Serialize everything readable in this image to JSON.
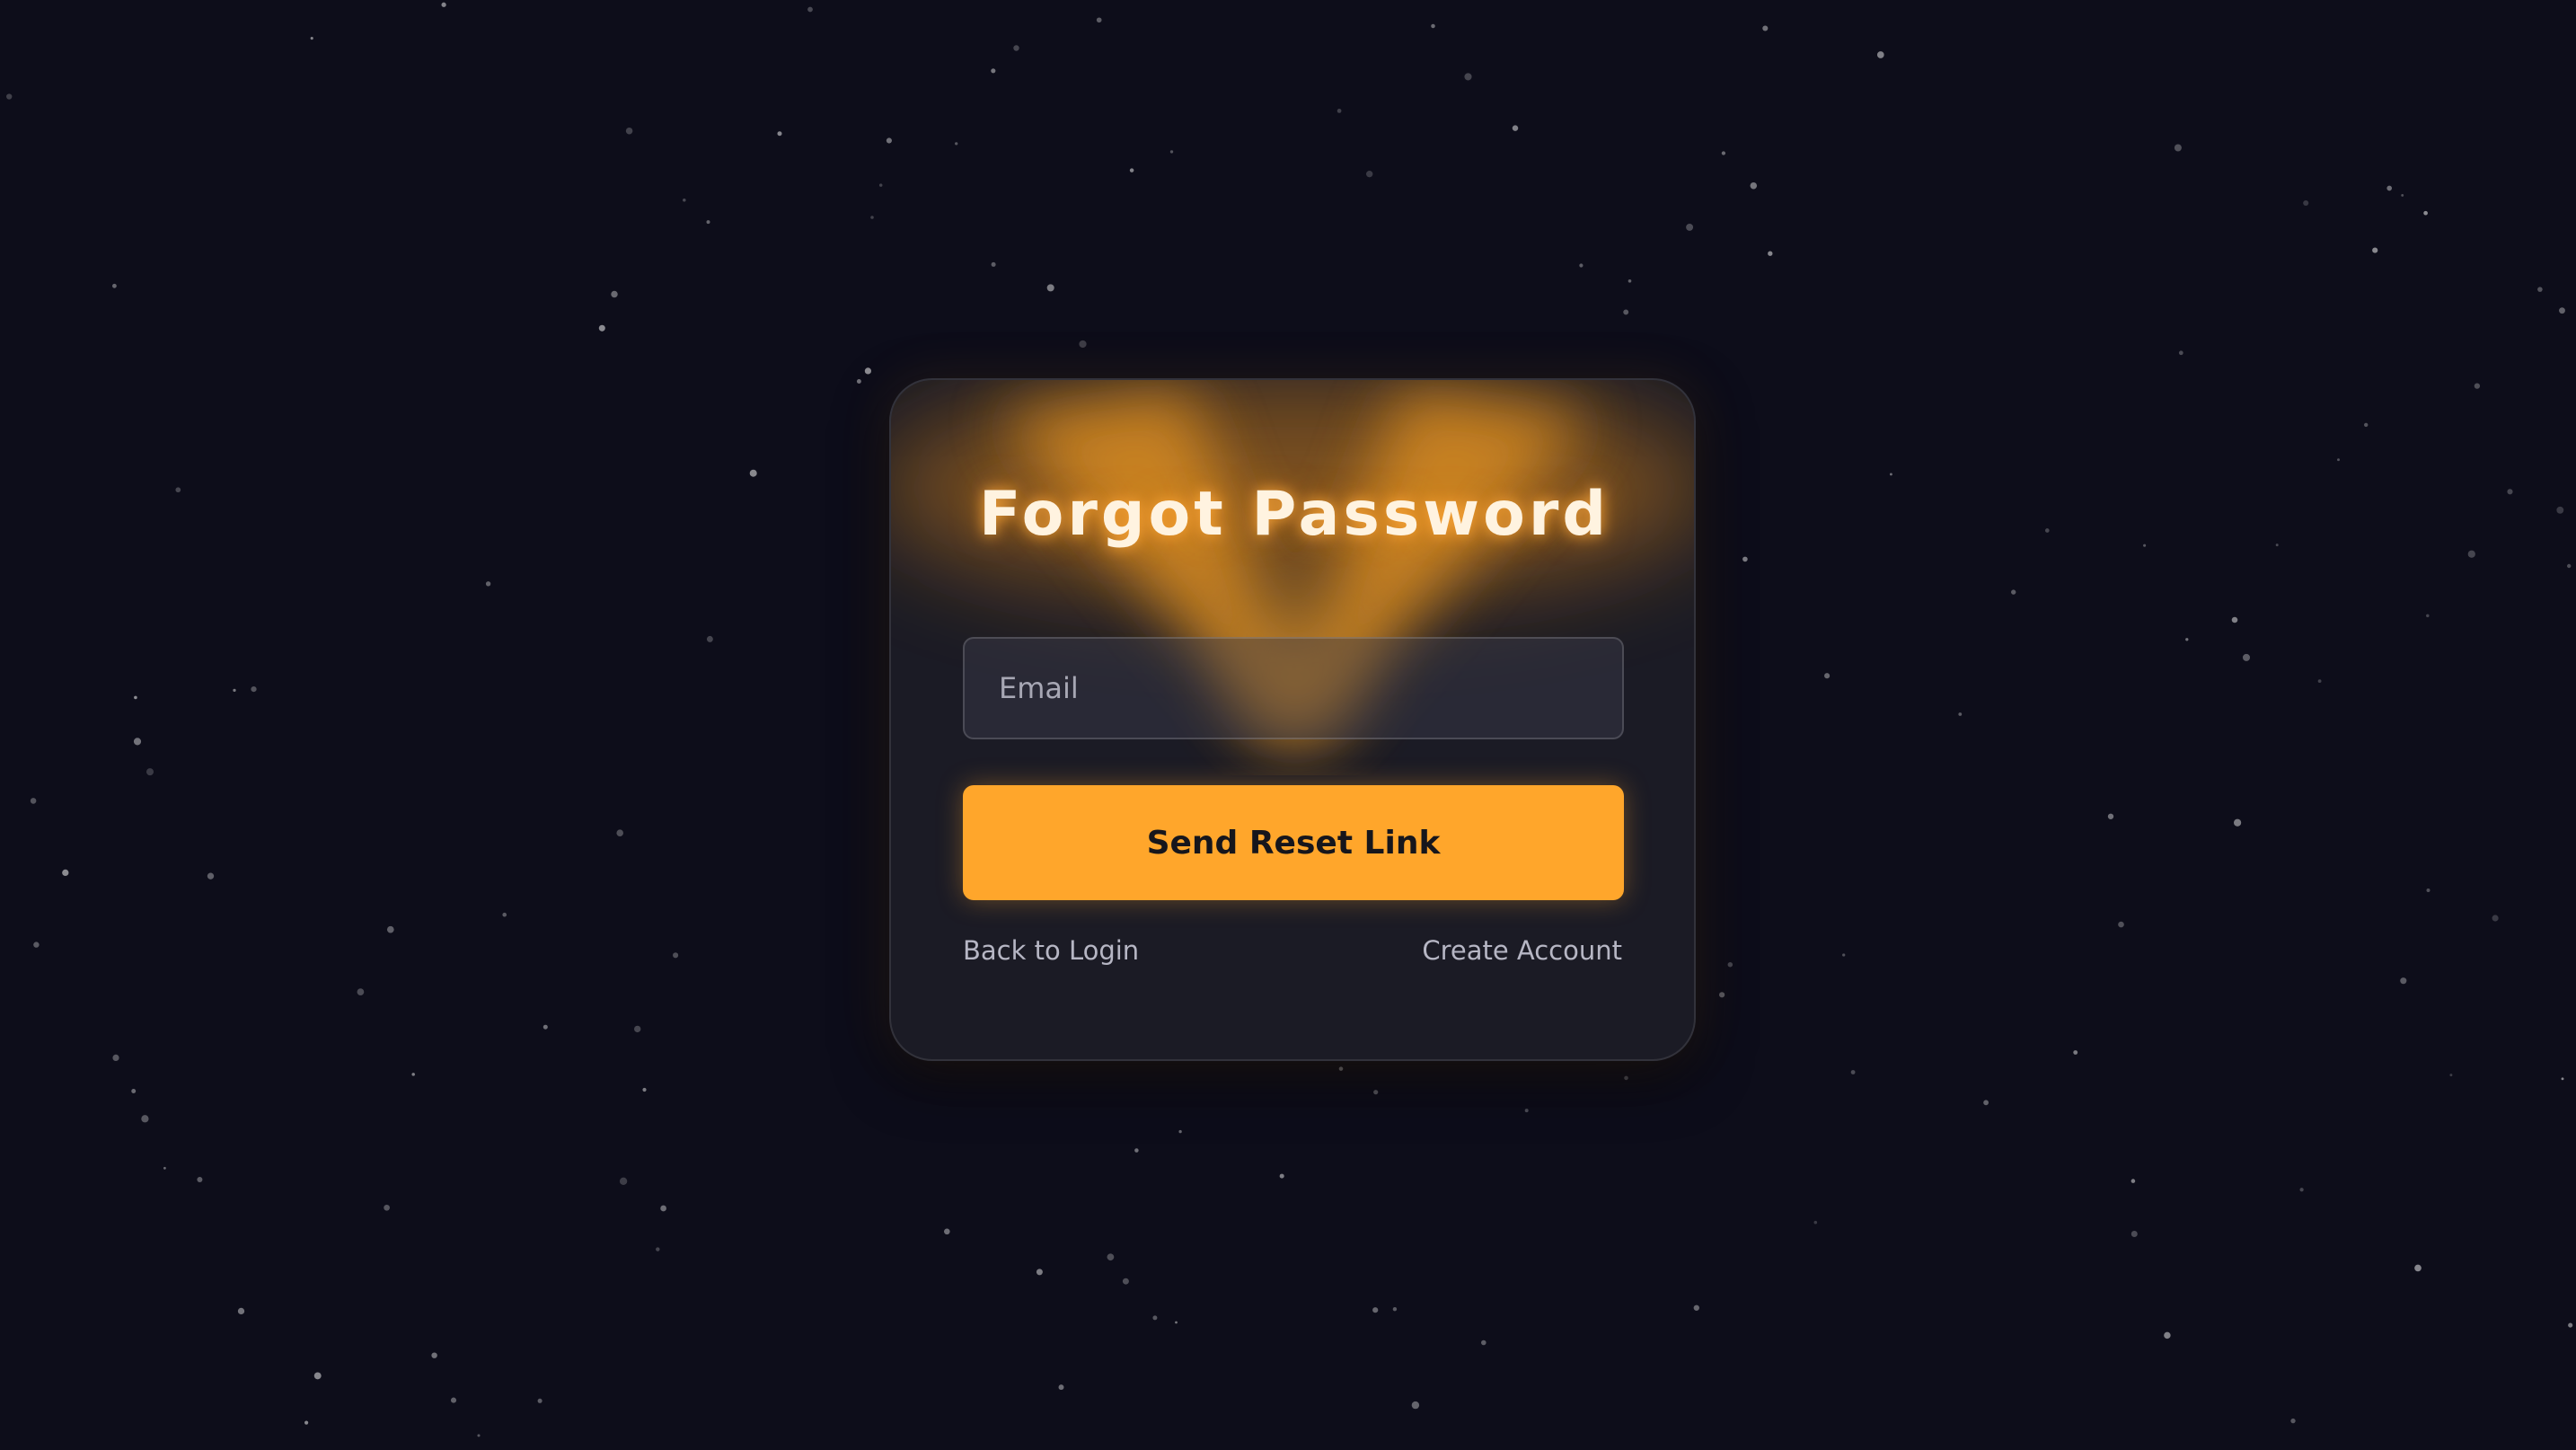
{
  "page": {
    "background_color": "#0d0d1a",
    "accent_color": "#ffa62b"
  },
  "card": {
    "title": "Forgot Password",
    "email_placeholder": "Email",
    "email_value": "",
    "submit_label": "Send Reset Link",
    "back_to_login_label": "Back to Login",
    "create_account_label": "Create Account"
  }
}
